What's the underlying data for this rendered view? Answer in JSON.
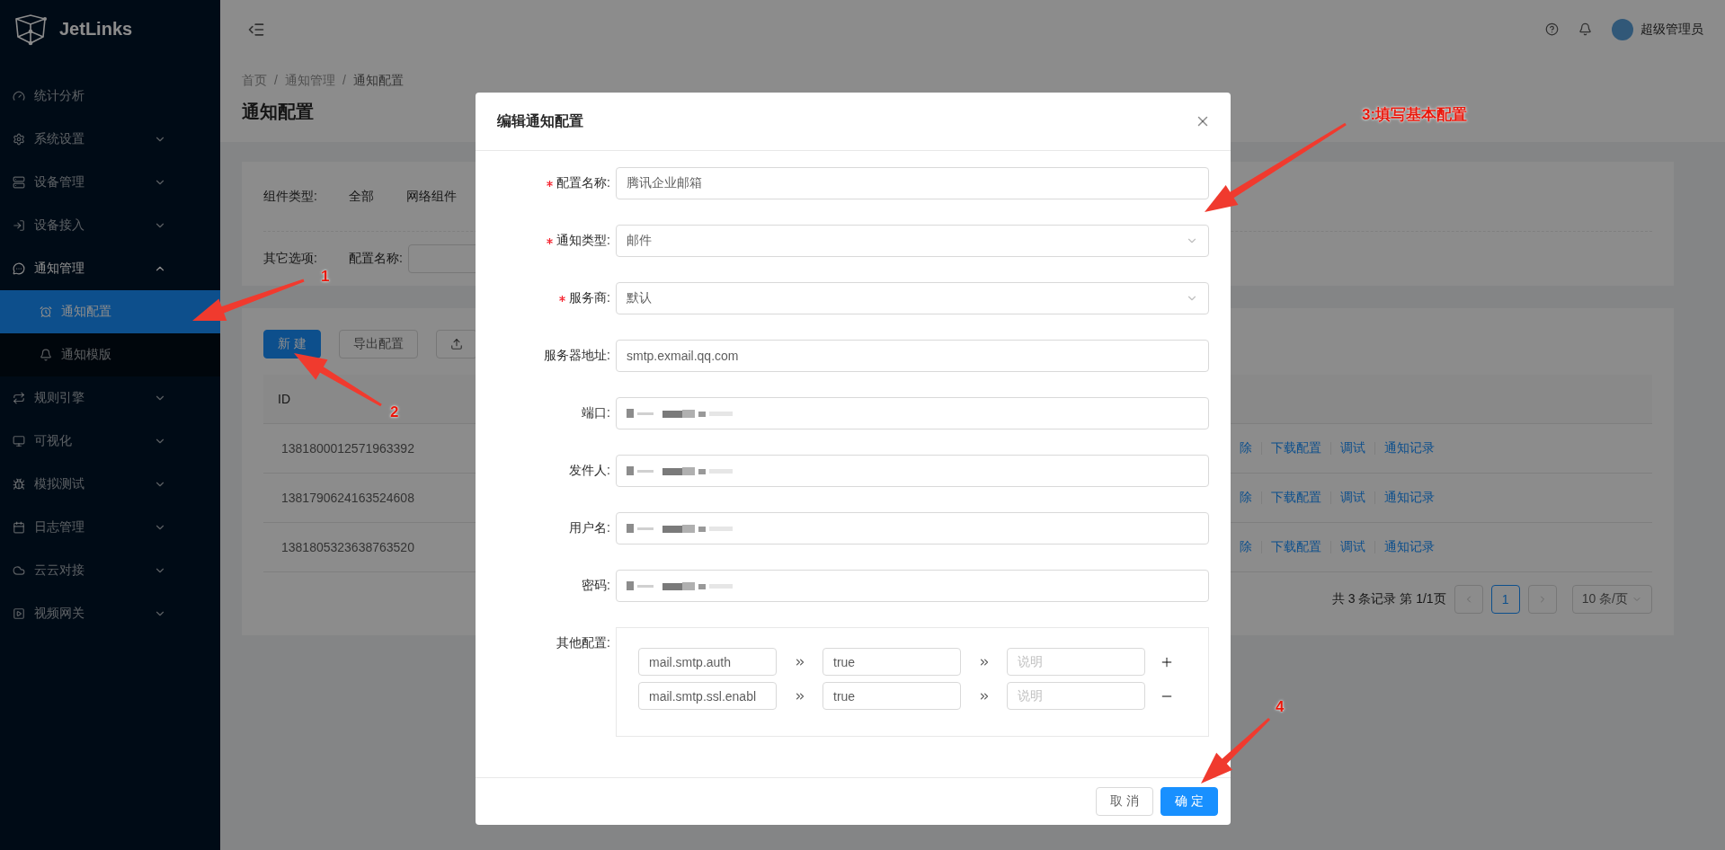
{
  "sidebar": {
    "logo": "JetLinks",
    "items": [
      {
        "label": "统计分析",
        "kind": "link",
        "selected": false
      },
      {
        "label": "系统设置",
        "kind": "group",
        "expanded": false,
        "selected": false
      },
      {
        "label": "设备管理",
        "kind": "group",
        "expanded": false,
        "selected": false
      },
      {
        "label": "设备接入",
        "kind": "group",
        "expanded": false,
        "selected": false
      },
      {
        "label": "通知管理",
        "kind": "group",
        "expanded": true,
        "selected": false,
        "children": [
          {
            "label": "通知配置",
            "selected": true
          },
          {
            "label": "通知模版",
            "selected": false
          }
        ]
      },
      {
        "label": "规则引擎",
        "kind": "group",
        "expanded": false,
        "selected": false
      },
      {
        "label": "可视化",
        "kind": "group",
        "expanded": false,
        "selected": false
      },
      {
        "label": "模拟测试",
        "kind": "group",
        "expanded": false,
        "selected": false
      },
      {
        "label": "日志管理",
        "kind": "group",
        "expanded": false,
        "selected": false
      },
      {
        "label": "云云对接",
        "kind": "group",
        "expanded": false,
        "selected": false
      },
      {
        "label": "视频网关",
        "kind": "group",
        "expanded": false,
        "selected": false
      }
    ]
  },
  "header": {
    "user": "超级管理员"
  },
  "page": {
    "breadcrumb": [
      {
        "text": "首页",
        "kind": "link"
      },
      {
        "text": "/",
        "kind": "separator"
      },
      {
        "text": "通知管理",
        "kind": "link"
      },
      {
        "text": "/",
        "kind": "separator"
      },
      {
        "text": "通知配置",
        "kind": "current"
      }
    ],
    "title": "通知配置"
  },
  "filters": {
    "component_type": {
      "label": "组件类型:",
      "options": [
        "全部",
        "网络组件"
      ]
    },
    "other_options": {
      "label": "其它选项:",
      "name_field_label": "配置名称:"
    }
  },
  "toolbar": {
    "buttons": [
      {
        "label": "新 建",
        "kind": "primary"
      },
      {
        "label": "导出配置",
        "kind": "default"
      },
      {
        "kind": "upload"
      }
    ]
  },
  "table": {
    "columns": [
      "ID"
    ],
    "rows": [
      {
        "id": "1381800012571963392",
        "actions": [
          "除",
          "下载配置",
          "调试",
          "通知记录"
        ]
      },
      {
        "id": "1381790624163524608",
        "actions": [
          "除",
          "下载配置",
          "调试",
          "通知记录"
        ]
      },
      {
        "id": "1381805323638763520",
        "actions": [
          "除",
          "下载配置",
          "调试",
          "通知记录"
        ]
      }
    ]
  },
  "pagination": {
    "summary": "共 3 条记录 第 1/1页",
    "pages": [
      {
        "label": "1",
        "selected": true
      }
    ],
    "page_size": "10 条/页"
  },
  "modal": {
    "title": "编辑通知配置",
    "fields": [
      {
        "label": "配置名称:",
        "required": true,
        "kind": "input",
        "redacted": false,
        "value": "腾讯企业邮箱"
      },
      {
        "label": "通知类型:",
        "required": true,
        "kind": "select",
        "redacted": false,
        "value": "邮件"
      },
      {
        "label": "服务商:",
        "required": true,
        "kind": "select",
        "redacted": false,
        "value": "默认"
      },
      {
        "label": "服务器地址:",
        "required": false,
        "kind": "input",
        "redacted": false,
        "value": "smtp.exmail.qq.com"
      },
      {
        "label": "端口:",
        "required": false,
        "kind": "input",
        "redacted": true
      },
      {
        "label": "发件人:",
        "required": false,
        "kind": "input",
        "redacted": true
      },
      {
        "label": "用户名:",
        "required": false,
        "kind": "input",
        "redacted": true
      },
      {
        "label": "密码:",
        "required": false,
        "kind": "input",
        "redacted": true
      }
    ],
    "other_config": {
      "label": "其他配置:",
      "rows": [
        {
          "key": "mail.smtp.auth",
          "value": "true",
          "note_placeholder": "说明",
          "kind": "add"
        },
        {
          "key": "mail.smtp.ssl.enabl",
          "value": "true",
          "note_placeholder": "说明",
          "kind": "remove"
        }
      ]
    },
    "buttons": [
      {
        "label": "取 消",
        "kind": "default"
      },
      {
        "label": "确 定",
        "kind": "primary"
      }
    ]
  },
  "annotations": [
    {
      "text": "1"
    },
    {
      "text": "2"
    },
    {
      "text": "3:填写基本配置"
    },
    {
      "text": "4"
    }
  ]
}
